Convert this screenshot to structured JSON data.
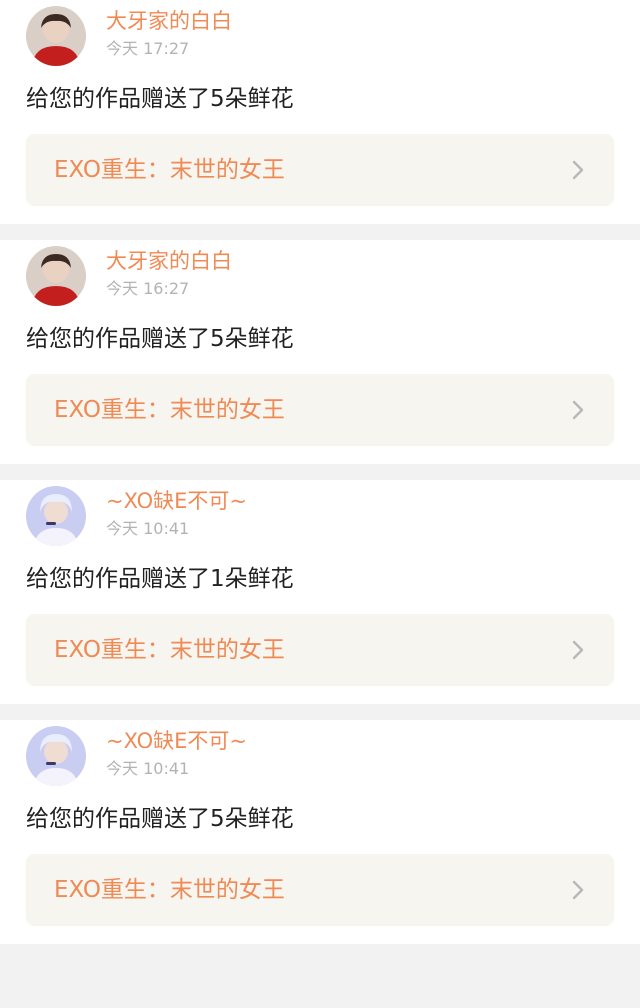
{
  "colors": {
    "accent": "#ef8a55",
    "timestamp": "#b3b3b3",
    "message": "#222222",
    "card_link_bg": "#f6f5ef",
    "separator": "#f2f2f2"
  },
  "notifications": [
    {
      "avatar_icon": "user-avatar-red-icon",
      "username": "大牙家的白白",
      "time": "今天 17:27",
      "message": "给您的作品赠送了5朵鲜花",
      "work_title": "EXO重生：末世的女王",
      "chevron_icon": "chevron-right-icon"
    },
    {
      "avatar_icon": "user-avatar-red-icon",
      "username": "大牙家的白白",
      "time": "今天 16:27",
      "message": "给您的作品赠送了5朵鲜花",
      "work_title": "EXO重生：末世的女王",
      "chevron_icon": "chevron-right-icon"
    },
    {
      "avatar_icon": "user-avatar-blue-icon",
      "username": "~XO缺E不可~",
      "time": "今天 10:41",
      "message": "给您的作品赠送了1朵鲜花",
      "work_title": "EXO重生：末世的女王",
      "chevron_icon": "chevron-right-icon"
    },
    {
      "avatar_icon": "user-avatar-blue-icon",
      "username": "~XO缺E不可~",
      "time": "今天 10:41",
      "message": "给您的作品赠送了5朵鲜花",
      "work_title": "EXO重生：末世的女王",
      "chevron_icon": "chevron-right-icon"
    }
  ]
}
